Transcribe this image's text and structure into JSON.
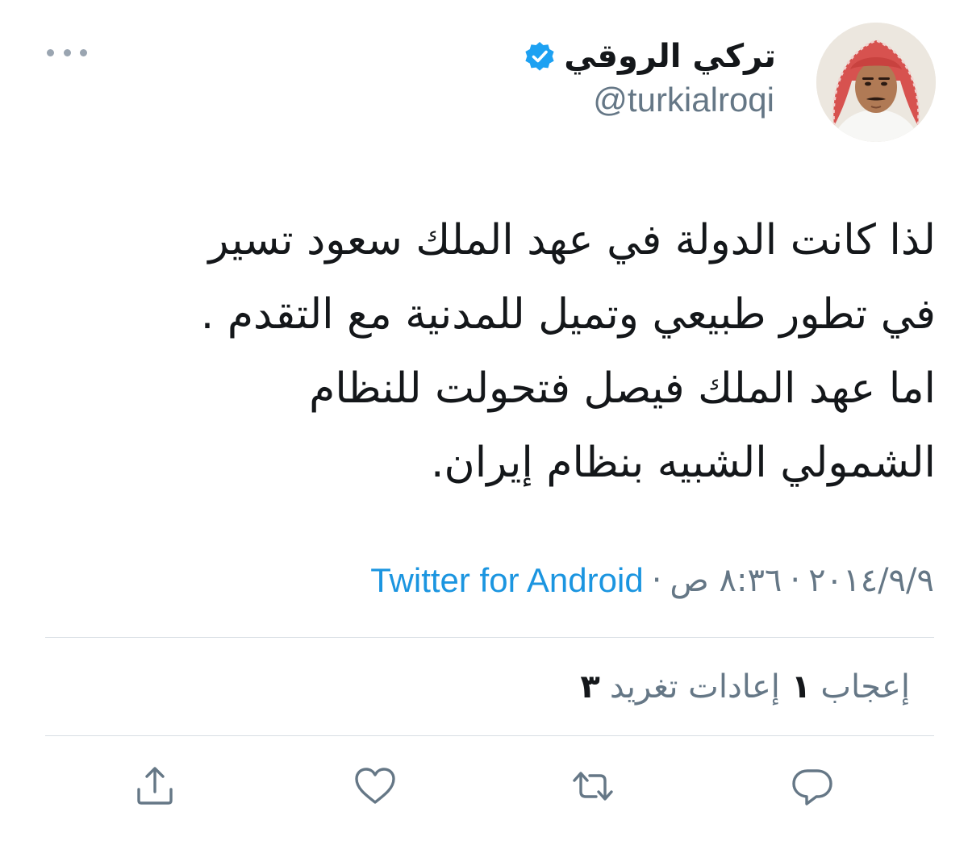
{
  "user": {
    "name": "تركي الروقي",
    "handle": "@turkialroqi",
    "verified": true,
    "avatar_icon": "avatar-photo"
  },
  "menu": {
    "more_icon": "more-horizontal-icon"
  },
  "tweet": {
    "lines": [
      "لذا كانت الدولة في عهد الملك سعود تسير",
      "في تطور طبيعي وتميل للمدنية مع التقدم .",
      "اما عهد الملك فيصل فتحولت للنظام",
      "الشمولي الشبيه بنظام إيران."
    ]
  },
  "meta": {
    "date": "٢٠١٤/٩/٩",
    "time": "٨:٣٦ ص",
    "separator": "·",
    "source": "Twitter for Android"
  },
  "stats": {
    "retweets_count": "٣",
    "retweets_label": "إعادات تغريد",
    "likes_count": "١",
    "likes_label": "إعجاب"
  },
  "actions": {
    "reply_icon": "reply-icon",
    "retweet_icon": "retweet-icon",
    "like_icon": "heart-icon",
    "share_icon": "share-icon"
  },
  "colors": {
    "link": "#1b95e0",
    "muted": "#657786",
    "text": "#14171a",
    "verified": "#1da1f2",
    "divider": "#d8dee4"
  }
}
